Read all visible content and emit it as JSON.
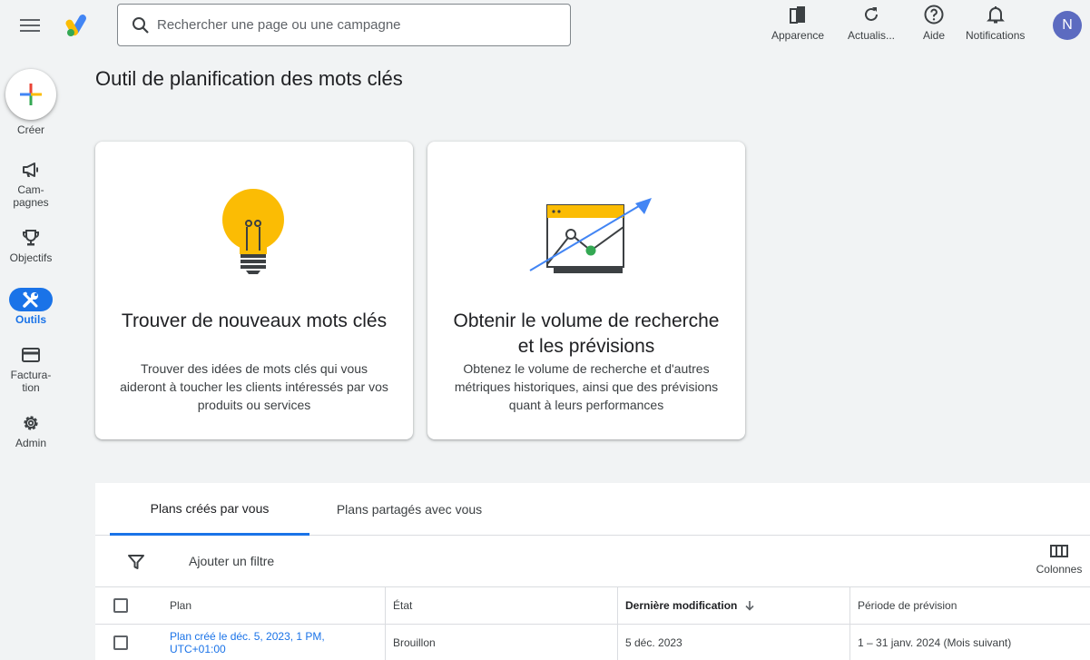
{
  "header": {
    "search_placeholder": "Rechercher une page ou une campagne",
    "actions": {
      "appearance": "Apparence",
      "refresh": "Actualis...",
      "help": "Aide",
      "notifications": "Notifications"
    },
    "avatar_initial": "N"
  },
  "sidebar": {
    "create_label": "Créer",
    "items": [
      {
        "label": "Cam-\npagnes",
        "icon": "megaphone-icon"
      },
      {
        "label": "Objectifs",
        "icon": "trophy-icon"
      },
      {
        "label": "Outils",
        "icon": "tools-icon",
        "active": true
      },
      {
        "label": "Factura-\ntion",
        "icon": "credit-card-icon"
      },
      {
        "label": "Admin",
        "icon": "gear-icon"
      }
    ]
  },
  "main": {
    "page_title": "Outil de planification des mots clés",
    "cards": [
      {
        "title": "Trouver de nouveaux mots clés",
        "description": "Trouver des idées de mots clés qui vous aideront à toucher les clients intéressés par vos produits ou services"
      },
      {
        "title": "Obtenir le volume de recherche et les prévisions",
        "description": "Obtenez le volume de recherche et d'autres métriques historiques, ainsi que des prévisions quant à leurs performances"
      }
    ]
  },
  "plans": {
    "tabs": [
      "Plans créés par vous",
      "Plans partagés avec vous"
    ],
    "filter_label": "Ajouter un filtre",
    "columns_label": "Colonnes",
    "headers": {
      "plan": "Plan",
      "status": "État",
      "last_modified": "Dernière modification",
      "forecast_period": "Période de prévision"
    },
    "rows": [
      {
        "plan": "Plan créé le déc. 5, 2023, 1 PM, UTC+01:00",
        "status": "Brouillon",
        "last_modified": "5 déc. 2023",
        "forecast_period": "1 – 31 janv. 2024 (Mois suivant)"
      }
    ]
  },
  "colors": {
    "accent": "#1a73e8",
    "logo_blue": "#4285f4",
    "logo_yellow": "#fbbc04",
    "logo_green": "#34a853"
  }
}
